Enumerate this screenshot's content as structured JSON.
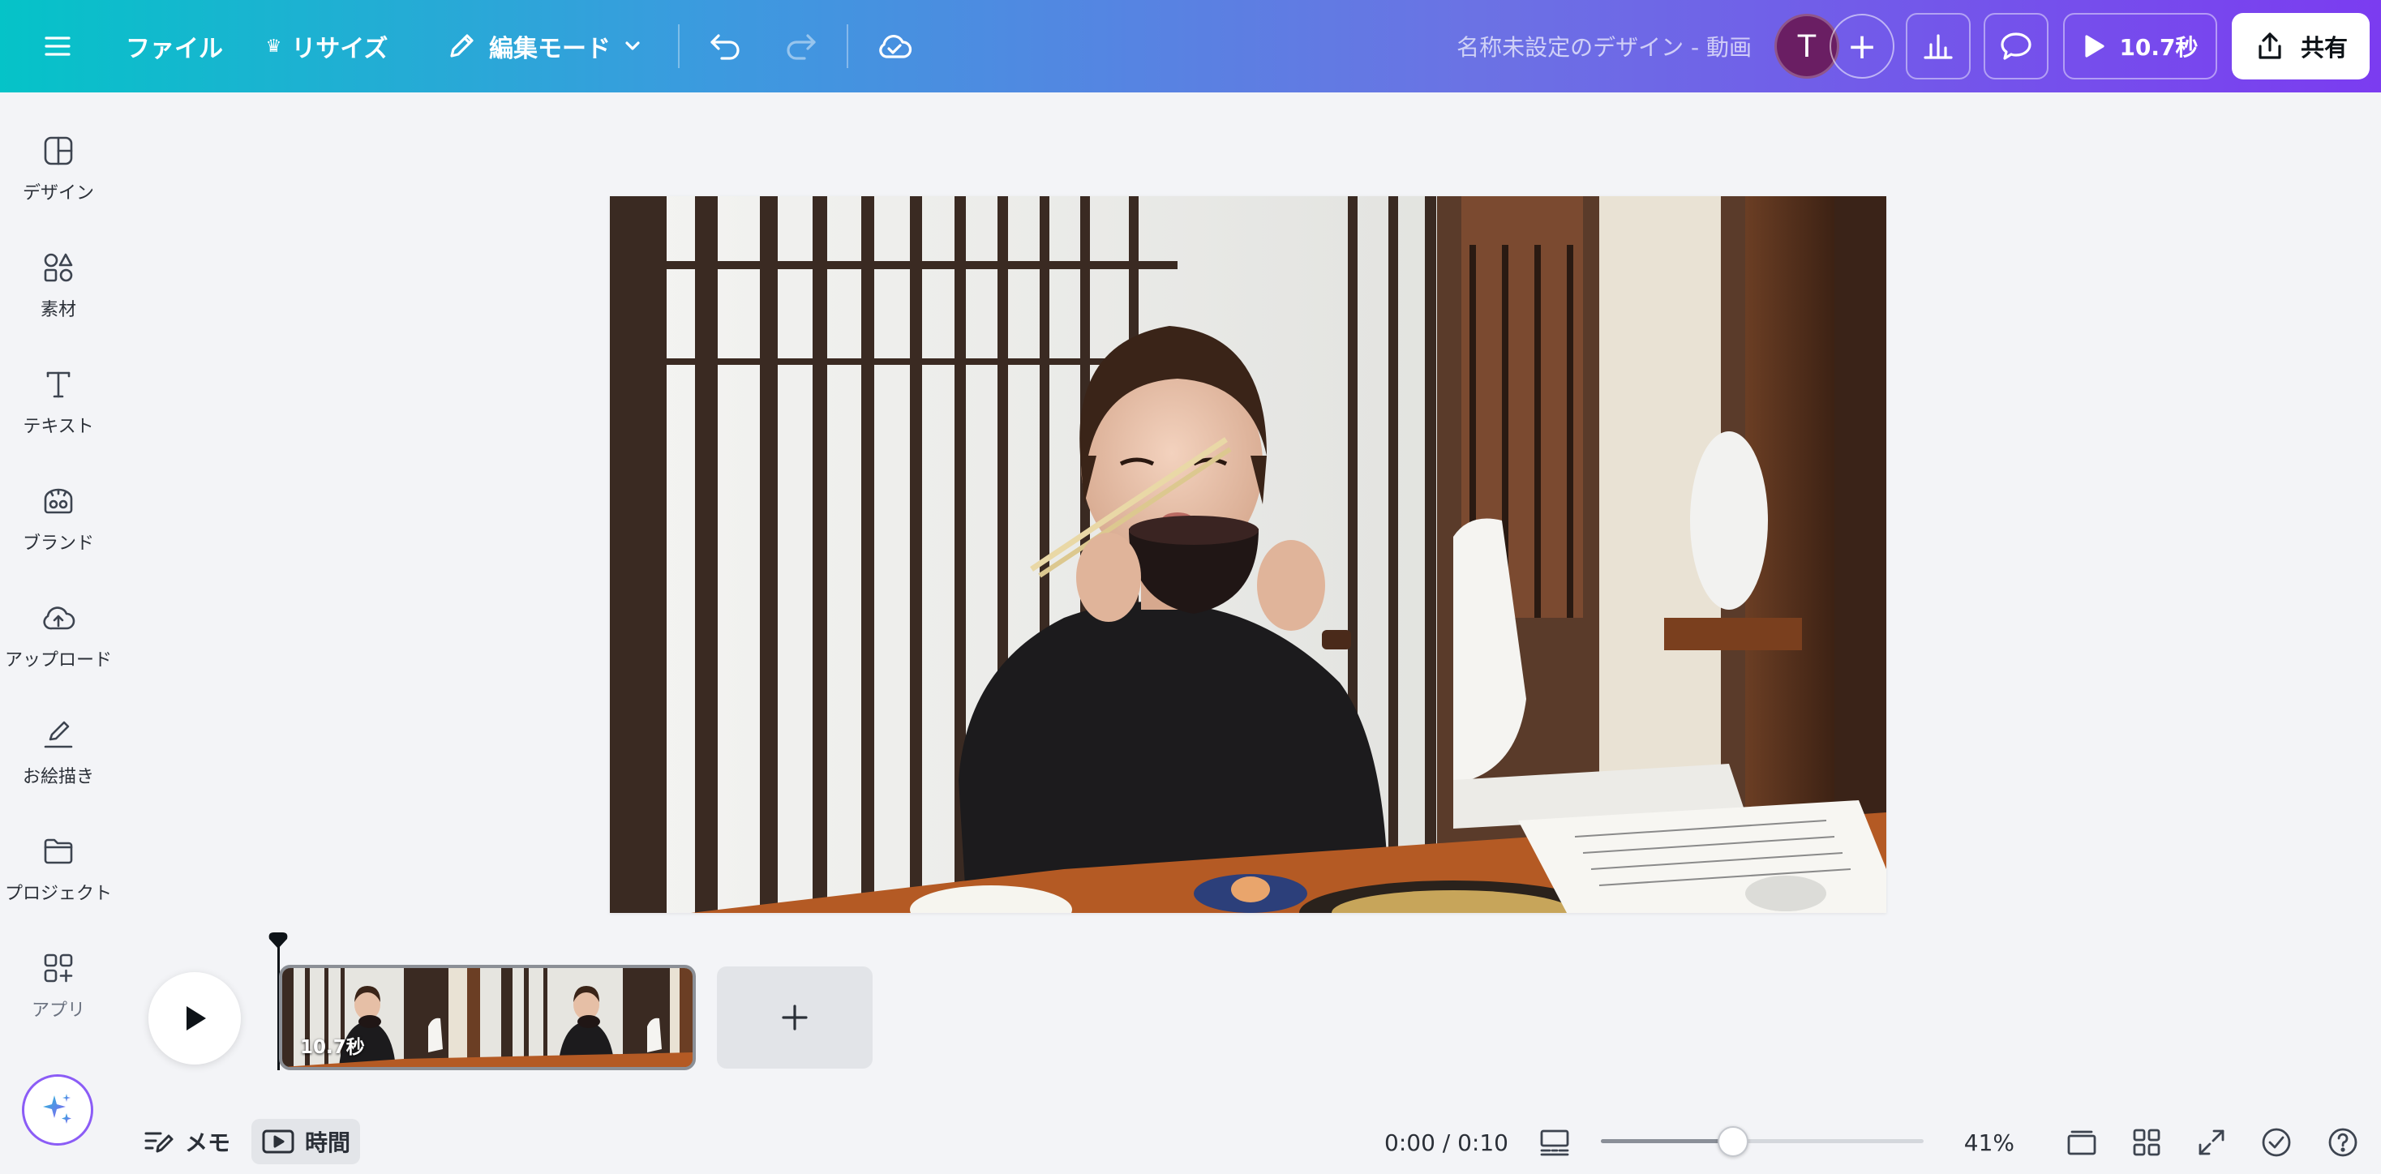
{
  "topbar": {
    "file_label": "ファイル",
    "resize_label": "リサイズ",
    "editmode_label": "編集モード",
    "design_title": "名称未設定のデザイン - 動画",
    "avatar_initial": "T",
    "present_label": "10.7秒",
    "share_label": "共有"
  },
  "sidebar": {
    "items": [
      {
        "label": "デザイン"
      },
      {
        "label": "素材"
      },
      {
        "label": "テキスト"
      },
      {
        "label": "ブランド"
      },
      {
        "label": "アップロード"
      },
      {
        "label": "お絵描き"
      },
      {
        "label": "プロジェクト"
      },
      {
        "label": "アプリ"
      }
    ]
  },
  "timeline": {
    "clip_duration": "10.7秒"
  },
  "bottombar": {
    "memo_label": "メモ",
    "time_label": "時間",
    "time_readout": "0:00 / 0:10",
    "zoom_value": "41%",
    "zoom_fraction": 0.41
  },
  "colors": {
    "gradient_start": "#05c3c8",
    "gradient_end": "#7b3cf0",
    "avatar_bg": "#6a1e63",
    "magic_accent": "#8b5cf6"
  }
}
